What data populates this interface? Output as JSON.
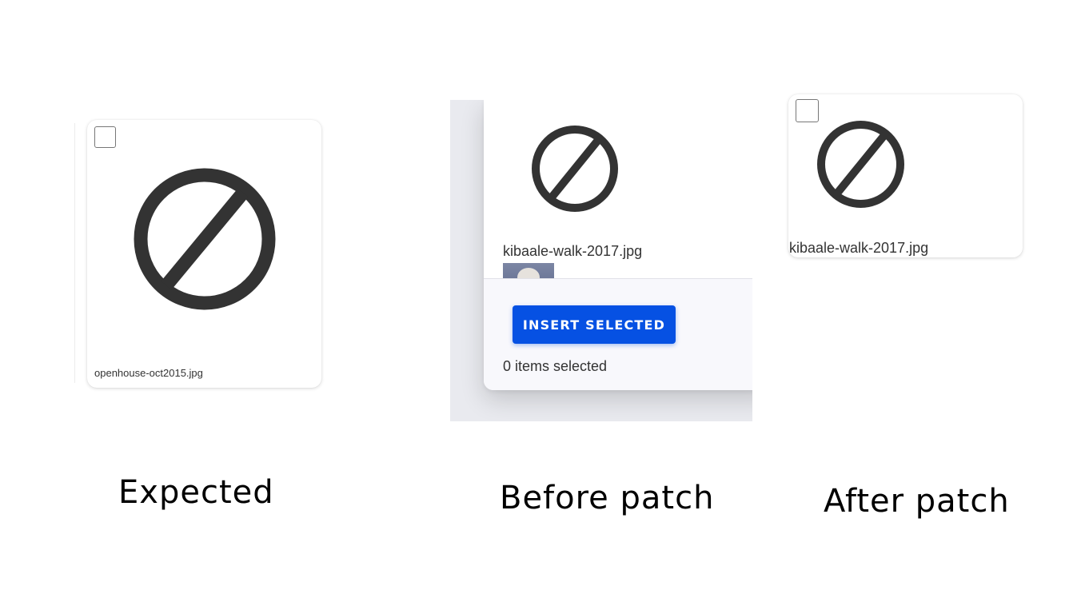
{
  "expected": {
    "caption": "Expected",
    "card": {
      "filename": "openhouse-oct2015.jpg",
      "checkbox_checked": false,
      "icon": "no-image-icon"
    }
  },
  "before_patch": {
    "caption": "Before patch",
    "card": {
      "filename": "kibaale-walk-2017.jpg",
      "icon": "no-image-icon"
    },
    "footer": {
      "insert_button_label": "INSERT SELECTED",
      "selected_count_text": "0 items selected"
    }
  },
  "after_patch": {
    "caption": "After patch",
    "card": {
      "filename": "kibaale-walk-2017.jpg",
      "checkbox_checked": false,
      "icon": "no-image-icon"
    }
  },
  "colors": {
    "icon": "#333333",
    "button": "#0651e3",
    "button_text": "#ffffff",
    "backdrop": "#e9eaef",
    "footer": "#f8f8fc"
  }
}
